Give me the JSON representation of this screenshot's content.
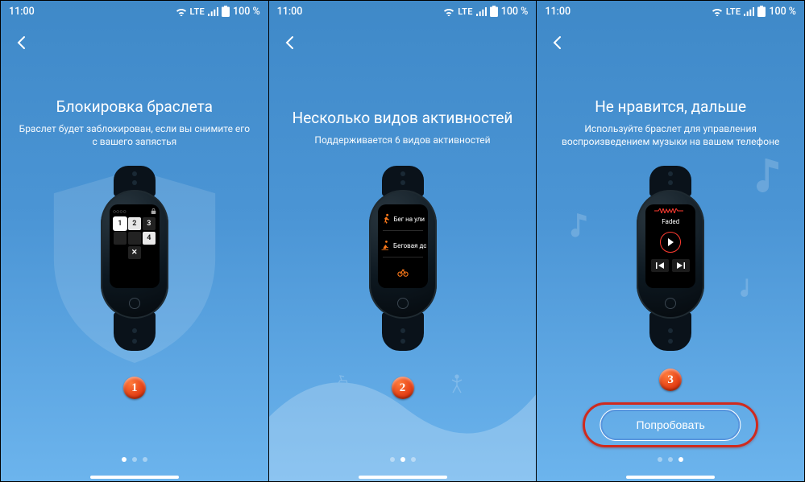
{
  "status": {
    "time": "11:00",
    "lte": "LTE",
    "battery": "100 %"
  },
  "screens": [
    {
      "title": "Блокировка браслета",
      "subtitle": "Браслет будет заблокирован, если вы снимите его с вашего запястья",
      "keypad": {
        "k1": "1",
        "k2": "2",
        "k3": "3",
        "k4": "4",
        "kx": "✕"
      },
      "step": "1",
      "activeDot": 0
    },
    {
      "title": "Несколько видов активностей",
      "subtitle": "Поддерживается 6 видов активностей",
      "activities": {
        "a1": "Бег на ули",
        "a2": "Беговая до"
      },
      "step": "2",
      "activeDot": 1
    },
    {
      "title": "Не нравится, дальше",
      "subtitle": "Используйте браслет для управления воспроизведением музыки на вашем телефоне",
      "music": {
        "track": "Faded"
      },
      "tryLabel": "Попробовать",
      "step": "3",
      "activeDot": 2
    }
  ]
}
